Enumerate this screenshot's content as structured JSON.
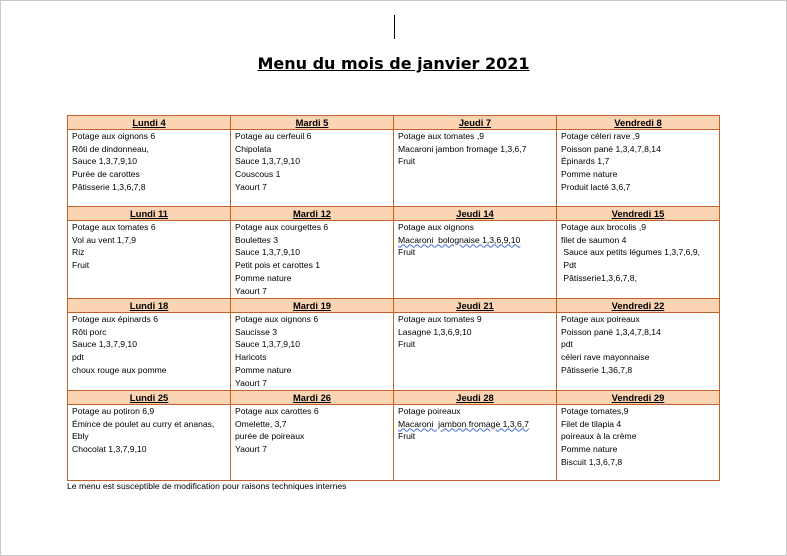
{
  "title": "Menu du mois de janvier 2021",
  "footnote": "Le menu est susceptible de modification pour raisons techniques internes",
  "weeks": [
    {
      "days": [
        {
          "header": "Lundi 4",
          "items": [
            "Potage aux oignons 6",
            "Rôti de dindonneau,",
            "Sauce 1,3,7,9,10",
            "Purée de carottes",
            "Pâtisserie 1,3,6,7,8"
          ]
        },
        {
          "header": "Mardi 5",
          "items": [
            "Potage au cerfeuil 6",
            "Chipolata",
            "Sauce 1,3,7,9,10",
            "Couscous 1",
            "Yaourt 7"
          ]
        },
        {
          "header": "Jeudi 7",
          "items": [
            "Potage aux tomates ,9",
            "Macaroni jambon fromage 1,3,6,7",
            "Fruit"
          ]
        },
        {
          "header": "Vendredi 8",
          "items": [
            "Potage céleri rave ,9",
            "Poisson pané 1,3,4,7,8,14",
            "Épinards 1,7",
            "Pomme nature",
            "Produit lacté 3,6,7"
          ]
        }
      ]
    },
    {
      "days": [
        {
          "header": "Lundi 11",
          "items": [
            "Potage aux tomates 6",
            "Vol au vent 1,7,9",
            "Riz",
            "Fruit"
          ]
        },
        {
          "header": "Mardi 12",
          "items": [
            "Potage aux courgettes 6",
            "Boulettes 3",
            "Sauce 1,3,7,9,10",
            "Petit pois et carottes 1",
            "Pomme nature",
            "Yaourt 7"
          ]
        },
        {
          "header": "Jeudi 14",
          "items": [
            "Potage aux oignons",
            "Macaroni  bolognaise 1,3,6,9,10",
            "Fruit"
          ]
        },
        {
          "header": "Vendredi 15",
          "items": [
            "Potage aux brocolis ,9",
            "filet de saumon 4",
            " Sauce aux petits légumes 1,3,7,6,9,",
            " Pdt",
            " Pâtisserie1,3,6,7,8,"
          ]
        }
      ]
    },
    {
      "days": [
        {
          "header": "Lundi 18",
          "items": [
            "Potage aux épinards 6",
            "Rôti porc",
            "Sauce 1,3,7,9,10",
            "pdt",
            "choux rouge aux pomme"
          ]
        },
        {
          "header": "Mardi 19",
          "items": [
            "Potage aux oignons 6",
            "Saucisse 3",
            "Sauce 1,3,7,9,10",
            "Haricots",
            "Pomme nature",
            "Yaourt 7"
          ]
        },
        {
          "header": "Jeudi 21",
          "items": [
            "Potage aux tomates 9",
            "Lasagne 1,3,6,9,10",
            "Fruit"
          ]
        },
        {
          "header": "Vendredi 22",
          "items": [
            "Potage aux poireaux",
            "Poisson pané 1,3,4,7,8,14",
            "pdt",
            "céleri rave mayonnaise",
            "Pâtisserie 1,36,7,8"
          ]
        }
      ]
    },
    {
      "days": [
        {
          "header": "Lundi 25",
          "items": [
            "Potage au potiron 6,9",
            "Émince de poulet au curry et ananas,",
            "Ebly",
            "Chocolat 1,3,7,9,10"
          ]
        },
        {
          "header": "Mardi 26",
          "items": [
            "Potage aux carottes 6",
            "Omelette, 3,7",
            "purée de poireaux",
            "Yaourt 7"
          ]
        },
        {
          "header": "Jeudi 28",
          "items": [
            "Potage poireaux",
            "Macaroni  jambon fromage 1,3,6,7",
            "Fruit"
          ]
        },
        {
          "header": "Vendredi 29",
          "items": [
            "Potage tomates,9",
            "Filet de tilapia 4",
            "poireaux à la crème",
            "Pomme nature",
            "Biscuit 1,3,6,7,8"
          ]
        }
      ]
    }
  ]
}
